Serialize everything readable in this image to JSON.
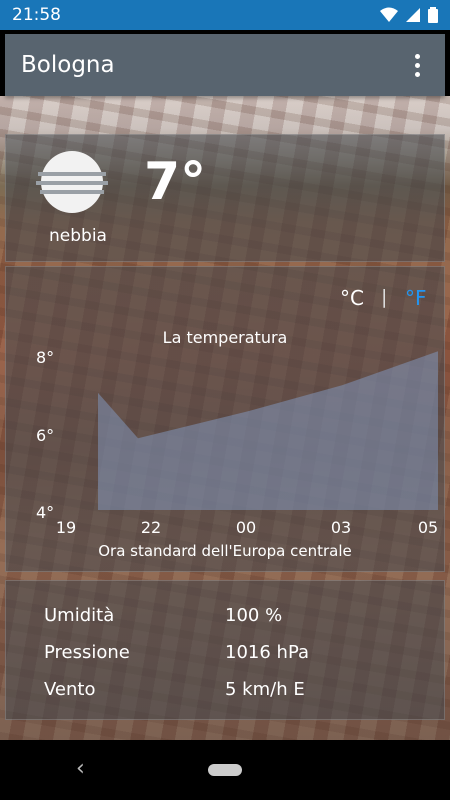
{
  "status_bar": {
    "time": "21:58"
  },
  "app_bar": {
    "title": "Bologna"
  },
  "current": {
    "temperature": "7°",
    "condition": "nebbia",
    "icon": "fog-icon"
  },
  "units": {
    "celsius": "°C",
    "separator": "|",
    "fahrenheit": "°F",
    "active_color": "#2196f3"
  },
  "chart": {
    "title": "La temperatura",
    "y_ticks": [
      "8°",
      "6°",
      "4°"
    ],
    "x_ticks": [
      "19",
      "22",
      "00",
      "03",
      "05"
    ],
    "x_axis_label": "Ora standard dell'Europa centrale"
  },
  "chart_data": {
    "type": "area",
    "title": "La temperatura",
    "xlabel": "Ora standard dell'Europa centrale",
    "ylabel": "",
    "categories": [
      "19",
      "22",
      "00",
      "03",
      "05"
    ],
    "values": [
      7.1,
      5.9,
      6.6,
      7.3,
      8.2
    ],
    "ylim": [
      4,
      8.5
    ]
  },
  "details": {
    "humidity_label": "Umidità",
    "humidity_value": "100 %",
    "pressure_label": "Pressione",
    "pressure_value": "1016 hPa",
    "wind_label": "Vento",
    "wind_value": "5 km/h E"
  },
  "colors": {
    "status_bar": "#1976b8",
    "app_bar": "#606c78"
  }
}
